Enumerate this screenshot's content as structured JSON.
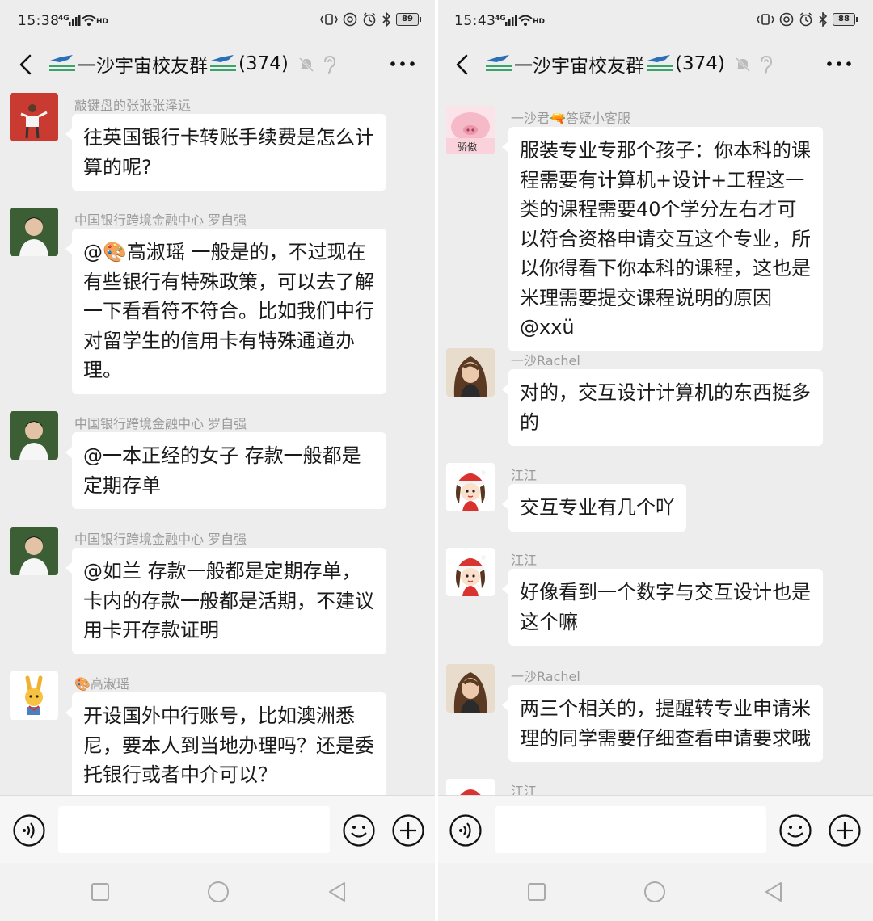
{
  "screens": [
    {
      "status": {
        "time": "15:38",
        "network": "4G",
        "wifi_label": "HD",
        "battery": "89"
      },
      "header": {
        "title": "一沙宇宙校友群",
        "count": "(374)"
      },
      "messages": [
        {
          "sender": "敲键盘的张张张泽远",
          "text": "往英国银行卡转账手续费是怎么计算的呢?",
          "avatar": "red-shirt-person-avatar"
        },
        {
          "sender": "中国银行跨境金融中心 罗自强",
          "text": "@🎨高淑瑶  一般是的，不过现在有些银行有特殊政策，可以去了解一下看看符不符合。比如我们中行对留学生的信用卡有特殊通道办理。",
          "avatar": "young-man-portrait-avatar"
        },
        {
          "sender": "中国银行跨境金融中心 罗自强",
          "text": "@一本正经的女子  存款一般都是定期存单",
          "avatar": "young-man-portrait-avatar"
        },
        {
          "sender": "中国银行跨境金融中心 罗自强",
          "text": "@如兰  存款一般都是定期存单，卡内的存款一般都是活期，不建议用卡开存款证明",
          "avatar": "young-man-portrait-avatar"
        },
        {
          "sender": "🎨高淑瑶",
          "text": "开设国外中行账号，比如澳洲悉尼，要本人到当地办理吗？还是委托银行或者中介可以？",
          "avatar": "cartoon-bunny-avatar"
        }
      ]
    },
    {
      "status": {
        "time": "15:43",
        "network": "4G",
        "wifi_label": "HD",
        "battery": "88"
      },
      "header": {
        "title": "一沙宇宙校友群",
        "count": "(374)"
      },
      "messages": [
        {
          "sender": "一沙君🔫答疑小客服",
          "text": "服装专业专那个孩子：你本科的课程需要有计算机+设计+工程这一类的课程需要40个学分左右才可以符合资格申请交互这个专业，所以你得看下你本科的课程，这也是米理需要提交课程说明的原因@xxü",
          "avatar": "pink-pig-avatar",
          "avatar_text": "骄傲"
        },
        {
          "sender": "一沙Rachel",
          "text": "对的，交互设计计算机的东西挺多的",
          "avatar": "woman-portrait-avatar"
        },
        {
          "sender": "江江",
          "text": "交互专业有几个吖",
          "avatar": "christmas-girl-cartoon-avatar"
        },
        {
          "sender": "江江",
          "text": "好像看到一个数字与交互设计也是这个嘛",
          "avatar": "christmas-girl-cartoon-avatar"
        },
        {
          "sender": "一沙Rachel",
          "text": "两三个相关的，提醒转专业申请米理的同学需要仔细查看申请要求哦",
          "avatar": "woman-portrait-avatar"
        },
        {
          "sender": "江江",
          "text": "",
          "avatar": "christmas-girl-cartoon-avatar"
        }
      ]
    }
  ],
  "icons": [
    "back-arrow-icon",
    "mute-bell-icon",
    "ear-icon",
    "more-icon",
    "voice-icon",
    "emoji-icon",
    "plus-icon",
    "nav-square-icon",
    "nav-circle-icon",
    "nav-back-icon"
  ],
  "colors": {
    "background": "#ededed",
    "bubble": "#ffffff",
    "sender_text": "#9a9a9a"
  }
}
